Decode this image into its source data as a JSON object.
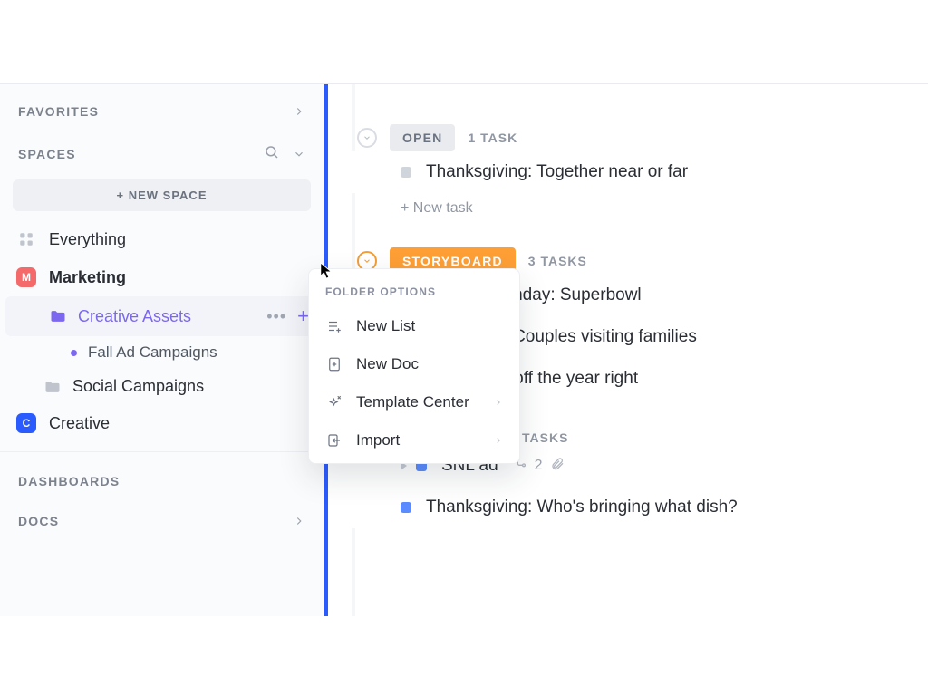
{
  "sidebar": {
    "favorites_label": "FAVORITES",
    "spaces_label": "SPACES",
    "new_space_label": "+ NEW SPACE",
    "dashboards_label": "DASHBOARDS",
    "docs_label": "DOCS",
    "everything_label": "Everything",
    "spaces": [
      {
        "initial": "M",
        "name": "Marketing"
      },
      {
        "initial": "C",
        "name": "Creative"
      }
    ],
    "marketing_folders": {
      "creative_assets": "Creative Assets",
      "social_campaigns": "Social Campaigns"
    },
    "lists": {
      "fall": "Fall Ad Campaigns"
    }
  },
  "main": {
    "groups": {
      "open": {
        "label": "OPEN",
        "count": "1 TASK"
      },
      "storyboard": {
        "label": "STORYBOARD",
        "count": "3 TASKS"
      },
      "hidden": {
        "count": "TASKS"
      }
    },
    "tasks": {
      "t1": "Thanksgiving: Together near or far",
      "t2": "Football Sunday: Superbowl",
      "t3": "Christmas: Couples visiting families",
      "t4_suffix": "rs: Starting off the year right",
      "t5": "SNL ad",
      "t5_sub": "2",
      "t6": "Thanksgiving: Who's bringing what dish?"
    },
    "new_task_label": "+ New task"
  },
  "popover": {
    "title": "FOLDER OPTIONS",
    "items": {
      "new_list": "New List",
      "new_doc": "New Doc",
      "template_center": "Template Center",
      "import": "Import"
    }
  }
}
